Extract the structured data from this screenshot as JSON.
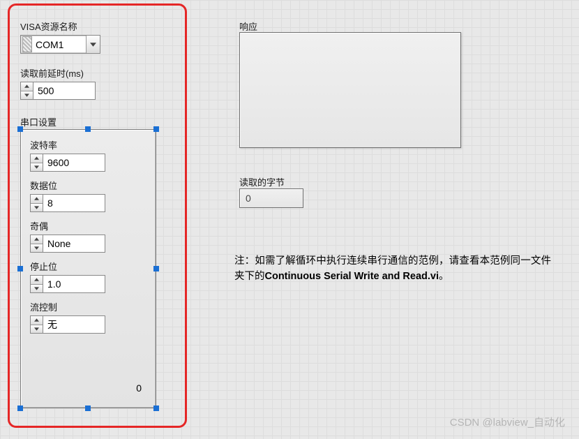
{
  "visa": {
    "label": "VISA资源名称",
    "value": "COM1"
  },
  "delay": {
    "label": "读取前延时(ms)",
    "value": "500"
  },
  "serial_cluster_label": "串口设置",
  "serial": {
    "baud": {
      "label": "波特率",
      "value": "9600"
    },
    "data": {
      "label": "数据位",
      "value": "8"
    },
    "parity": {
      "label": "奇偶",
      "value": "None"
    },
    "stop": {
      "label": "停止位",
      "value": "1.0"
    },
    "flow": {
      "label": "流控制",
      "value": "无",
      "extra": "0"
    }
  },
  "response": {
    "label": "响应",
    "value": ""
  },
  "bytes": {
    "label": "读取的字节",
    "value": "0"
  },
  "note": {
    "prefix": "注：如需了解循环中执行连续串行通信的范例，请查看本范例同一文件夹下的",
    "bold": "Continuous Serial Write and Read.vi",
    "suffix": "。"
  },
  "watermark": "CSDN @labview_自动化"
}
